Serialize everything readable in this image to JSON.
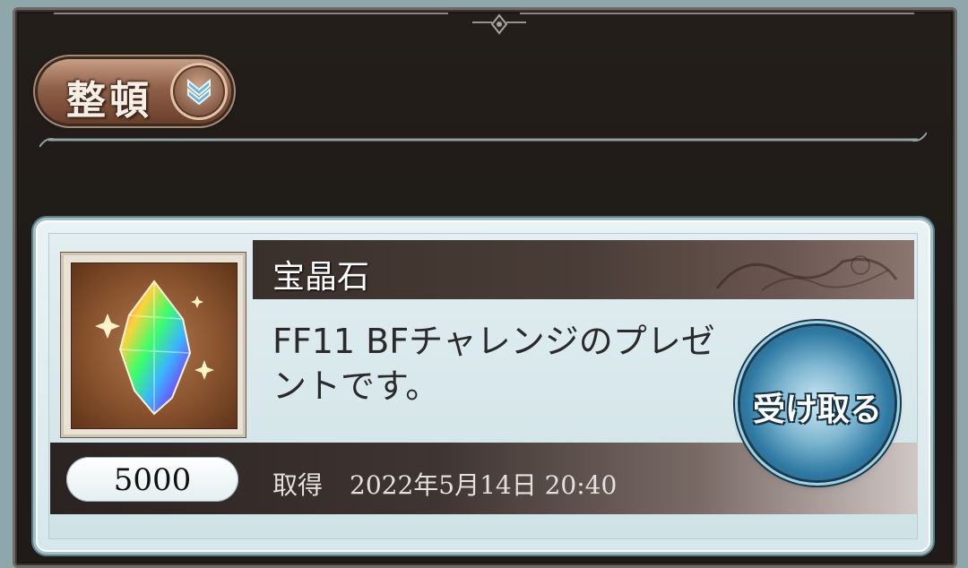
{
  "sort": {
    "label": "整頓",
    "icon": "chevron-double-down-icon"
  },
  "present": {
    "item_name": "宝晶石",
    "description": "FF11 BFチャレンジのプレゼントです。",
    "quantity": "5000",
    "acquired_label": "取得",
    "acquired_datetime": "2022年5月14日 20:40",
    "receive_label": "受け取る",
    "item_icon": "crystal-icon"
  },
  "colors": {
    "frame": "#231e1a",
    "card": "#e2eef1",
    "accent": "#2f7aa3"
  }
}
